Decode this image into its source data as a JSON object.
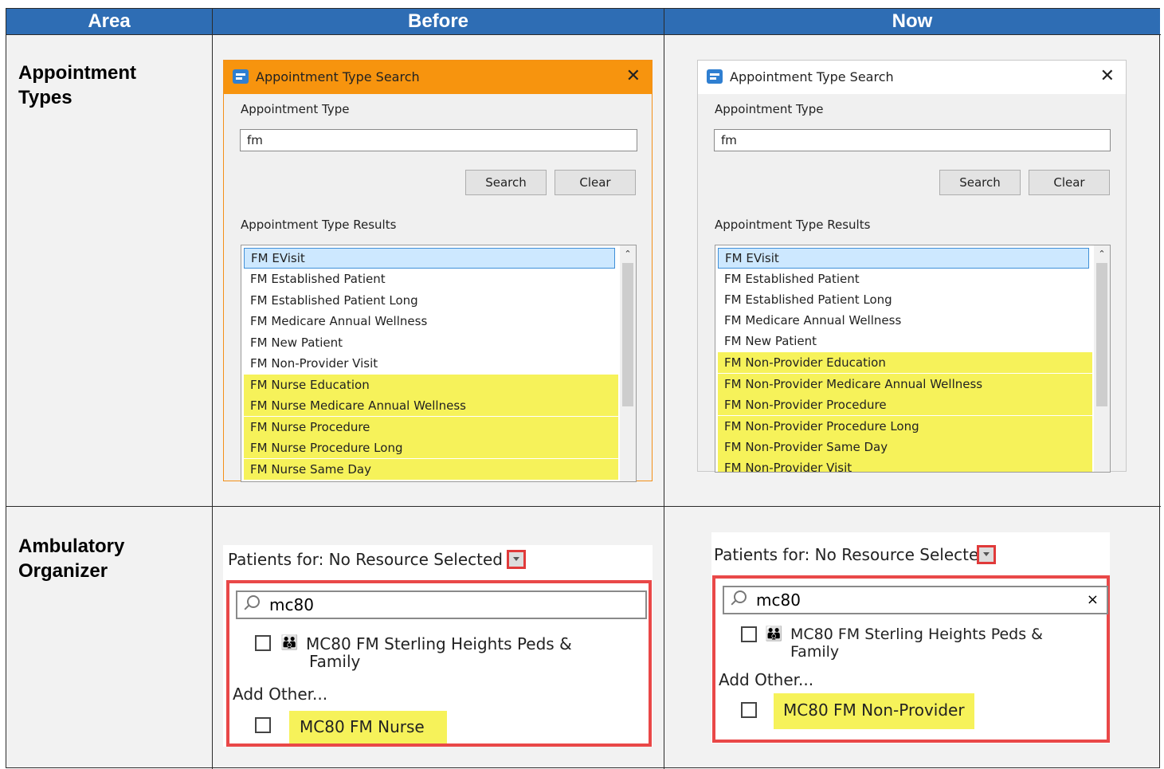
{
  "table": {
    "headers": [
      "Area",
      "Before",
      "Now"
    ]
  },
  "rows": [
    {
      "area_line1": "Appointment",
      "area_line2": "Types"
    },
    {
      "area_line1": "Ambulatory",
      "area_line2": "Organizer"
    }
  ],
  "dialog": {
    "title": "Appointment Type Search",
    "close": "✕",
    "type_group": "Appointment Type",
    "input_value": "fm",
    "search_label": "Search",
    "clear_label": "Clear",
    "results_group": "Appointment Type Results",
    "scroll_up": "⌃"
  },
  "before_results": [
    "FM EVisit",
    "FM Established Patient",
    "FM Established Patient Long",
    "FM Medicare Annual Wellness",
    "FM New Patient",
    "FM Non-Provider Visit",
    "FM Nurse Education",
    "FM Nurse Medicare Annual Wellness",
    "FM Nurse Procedure",
    "FM Nurse Procedure Long",
    "FM Nurse Same Day"
  ],
  "now_results": [
    "FM EVisit",
    "FM Established Patient",
    "FM Established Patient Long",
    "FM Medicare Annual Wellness",
    "FM New Patient",
    "FM Non-Provider Education",
    "FM Non-Provider Medicare Annual Wellness",
    "FM Non-Provider Procedure",
    "FM Non-Provider Procedure Long",
    "FM Non-Provider Same Day",
    "FM Non-Provider Visit"
  ],
  "organizer": {
    "patients_for": "Patients for: No Resource Selected",
    "search_value": "mc80",
    "search_clear": "×",
    "group_icon": "👪",
    "group_line1": "MC80 FM Sterling Heights Peds &",
    "group_line2": "Family",
    "add_other": "Add Other...",
    "before_item": "MC80 FM Nurse",
    "now_item": "MC80 FM Non-Provider"
  },
  "colors": {
    "header_bg": "#2e6db4",
    "highlight": "#f6f25a",
    "title_orange": "#f7940e",
    "red_outline": "#e94848"
  }
}
